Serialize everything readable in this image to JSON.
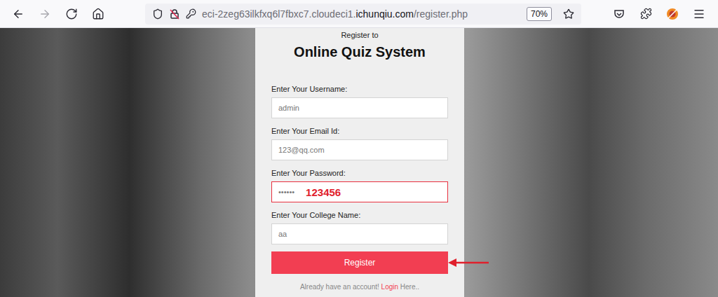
{
  "browser": {
    "nav": [
      {
        "name": "back",
        "enabled": true
      },
      {
        "name": "forward",
        "enabled": false
      },
      {
        "name": "reload",
        "enabled": true
      },
      {
        "name": "home",
        "enabled": true
      }
    ],
    "url": {
      "prefix": "eci-2zeg63ilkfxq6l7fbxc7.cloudeci1.",
      "domain": "ichunqiu.com",
      "path": "/register.php"
    },
    "zoom": "70%"
  },
  "form": {
    "subtitle": "Register to",
    "title": "Online Quiz System",
    "fields": [
      {
        "label": "Enter Your Username:",
        "value": "admin",
        "annotation": ""
      },
      {
        "label": "Enter Your Email Id:",
        "value": "123@qq.com",
        "annotation": ""
      },
      {
        "label": "Enter Your Password:",
        "value": "••••••",
        "annotation": "123456"
      },
      {
        "label": "Enter Your College Name:",
        "value": "aa",
        "annotation": ""
      }
    ],
    "button": "Register",
    "footer": {
      "text": "Already have an account!",
      "link": "Login",
      "suffix": "Here.."
    }
  }
}
